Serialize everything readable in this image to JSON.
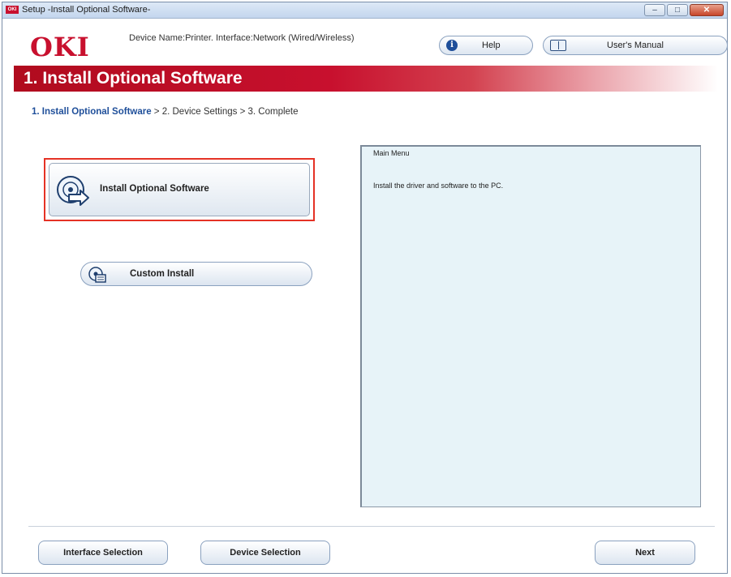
{
  "window": {
    "title": "Setup -Install Optional Software-",
    "app_icon_text": "OKI",
    "controls": {
      "minimize": "–",
      "maximize": "□",
      "close": "✕"
    }
  },
  "header": {
    "logo": "OKI",
    "device_info": "Device Name:Printer. Interface:Network (Wired/Wireless)",
    "help_label": "Help",
    "manual_label": "User's Manual",
    "help_icon": "info-icon",
    "manual_icon": "book-icon"
  },
  "banner": {
    "title": "1. Install Optional Software"
  },
  "breadcrumb": {
    "current": "1. Install Optional Software",
    "rest": " > 2. Device Settings > 3. Complete"
  },
  "options": {
    "install_label": "Install Optional Software",
    "install_icon": "disc-install-icon",
    "custom_label": "Custom Install",
    "custom_icon": "custom-install-icon"
  },
  "info_panel": {
    "title": "Main Menu",
    "text": "Install the driver and software to the PC."
  },
  "footer": {
    "interface_label": "Interface Selection",
    "device_label": "Device Selection",
    "next_label": "Next"
  },
  "colors": {
    "brand_red": "#c8102e",
    "highlight_border": "#e53225",
    "breadcrumb_current": "#1f4f9a",
    "panel_bg": "#e7f3f8"
  }
}
